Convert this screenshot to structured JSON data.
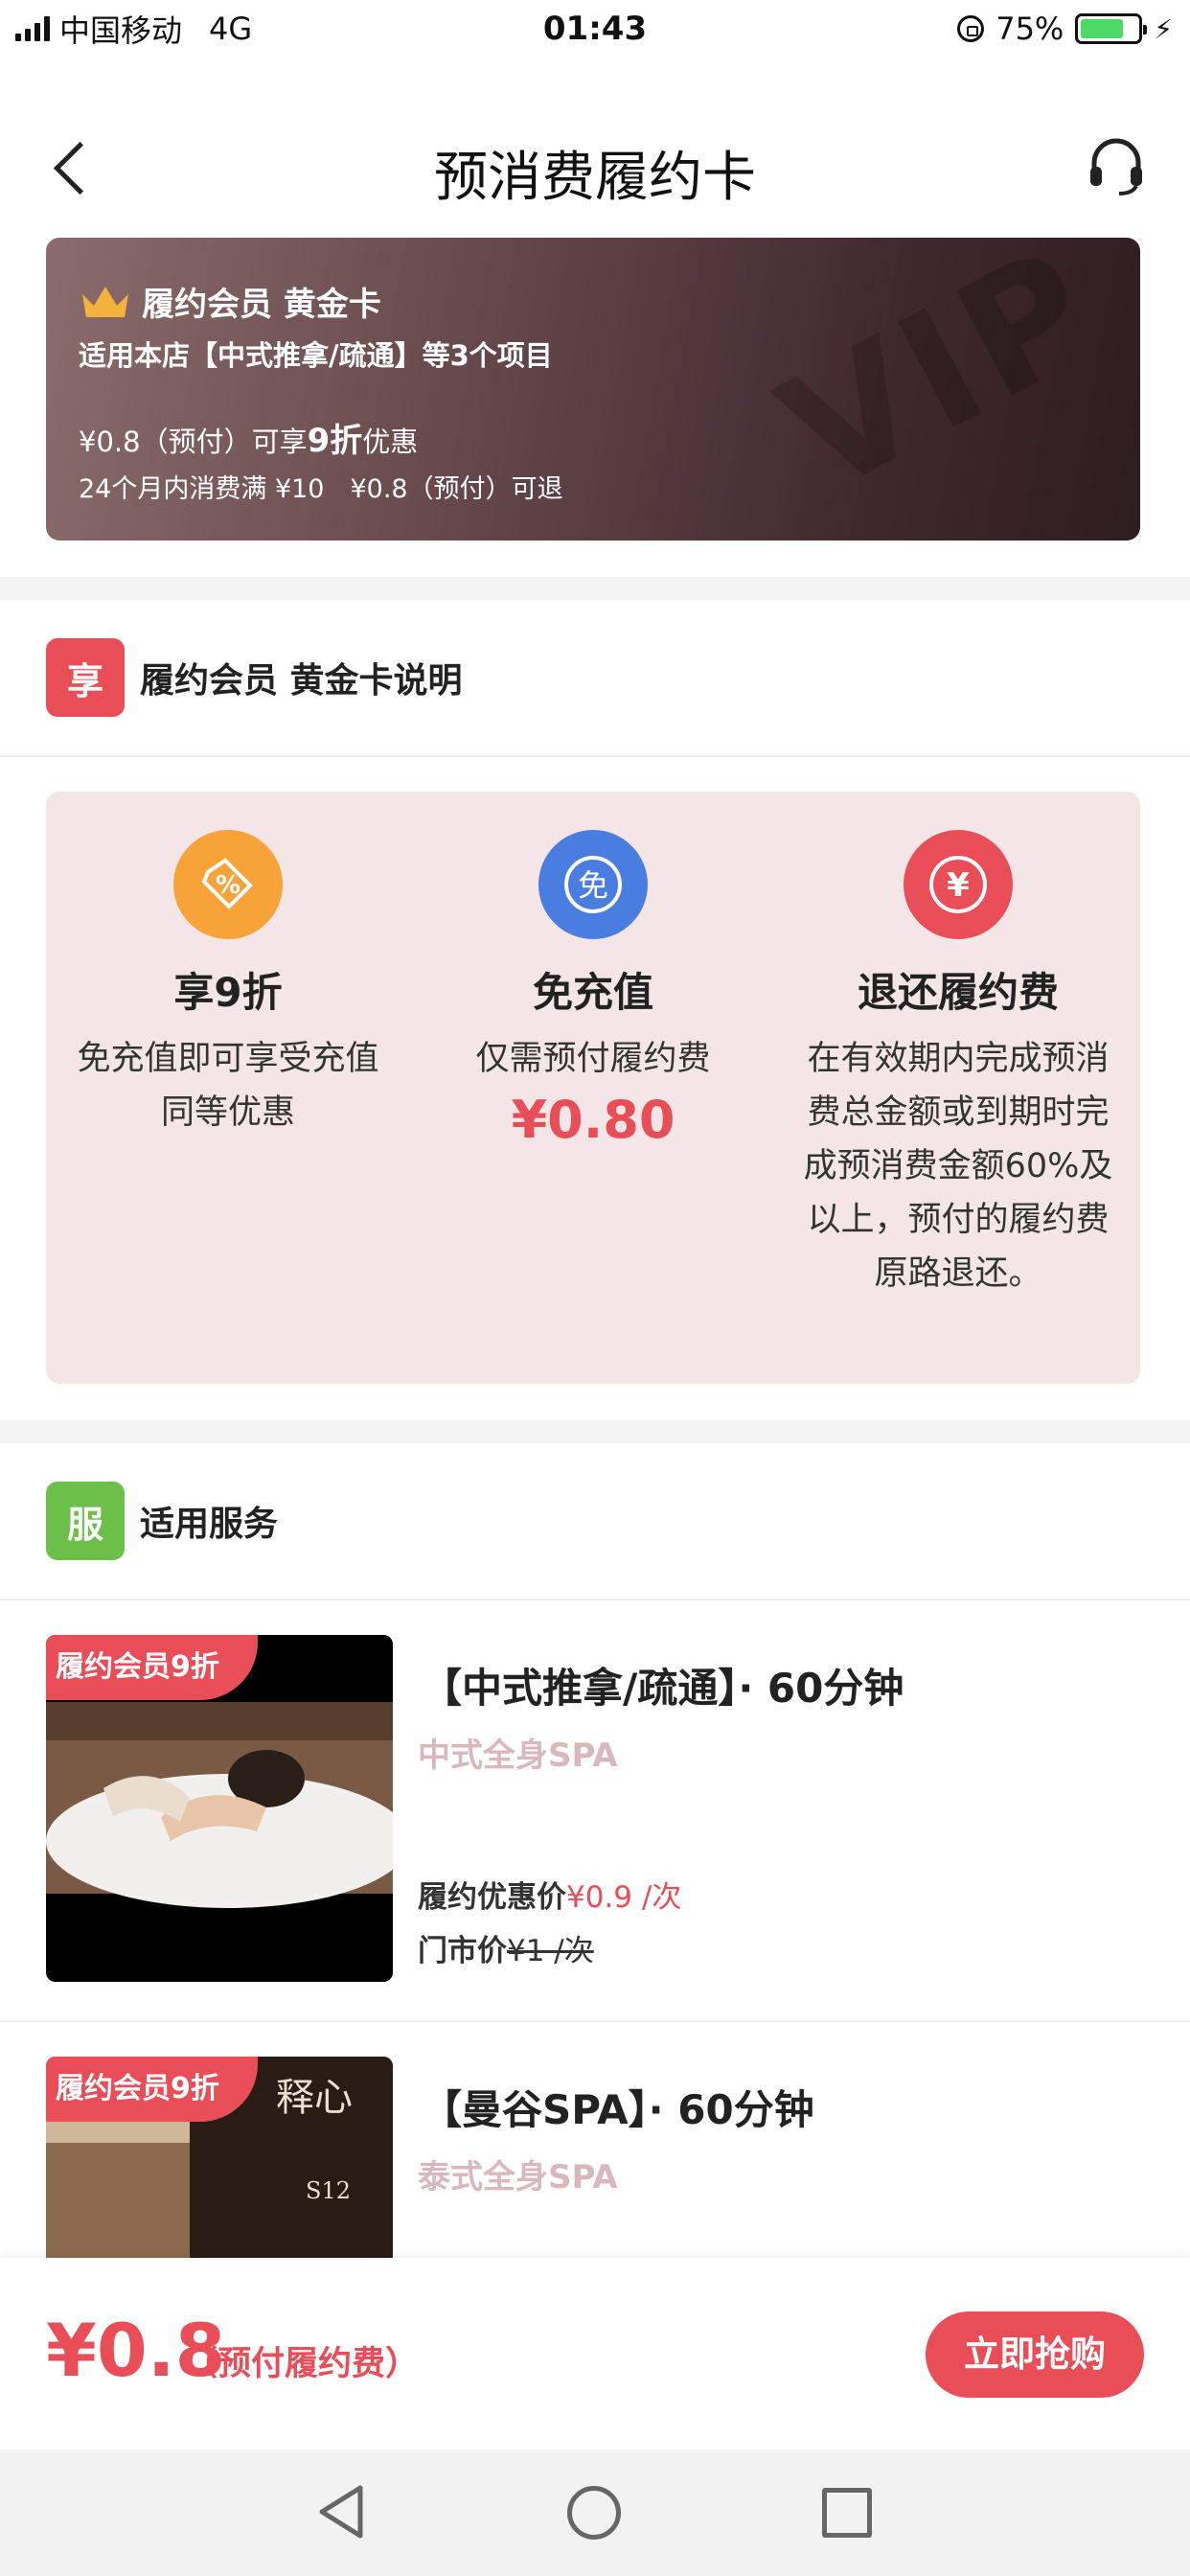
{
  "status_bar": {
    "carrier": "中国移动",
    "network": "4G",
    "time": "01:43",
    "battery": "75%",
    "battery_level": 0.75
  },
  "nav": {
    "title": "预消费履约卡",
    "back_icon": "back-chevron-icon",
    "service_icon": "headset-icon"
  },
  "card": {
    "title": "履约会员 黄金卡",
    "scope": "适用本店【中式推拿/疏通】等3个项目",
    "line1_prefix": "¥0.8（预付）可享",
    "line1_discount": "9折",
    "line1_suffix": "优惠",
    "line2": "24个月内消费满 ¥10　¥0.8（预付）可退",
    "watermark": "VIP"
  },
  "explain_section": {
    "badge": "享",
    "badge_color": "#e94e58",
    "title": "履约会员 黄金卡说明"
  },
  "benefits": [
    {
      "icon": "percent-tag-icon",
      "icon_color": "#f8a33a",
      "title": "享9折",
      "desc": "免充值即可享受充值同等优惠"
    },
    {
      "icon": "free-icon",
      "icon_color": "#4a7de0",
      "title": "免充值",
      "desc": "仅需预付履约费",
      "price": "¥0.80"
    },
    {
      "icon": "yen-icon",
      "icon_color": "#e94e58",
      "title": "退还履约费",
      "desc": "在有效期内完成预消费总金额或到期时完成预消费金额60%及以上，预付的履约费原路退还。"
    }
  ],
  "services_section": {
    "badge": "服",
    "badge_color": "#6cc04a",
    "title": "适用服务"
  },
  "services": [
    {
      "tag": "履约会员9折",
      "name": "【中式推拿/疏通】· 60分钟",
      "sub": "中式全身SPA",
      "price_label": "履约优惠价",
      "price": "¥0.9 /次",
      "orig_label": "门市价",
      "orig_price": "¥1 /次"
    },
    {
      "tag": "履约会员9折",
      "name": "【曼谷SPA】· 60分钟",
      "sub": "泰式全身SPA",
      "image_text": "释心",
      "image_room": "S12"
    }
  ],
  "bottom_bar": {
    "price": "¥0.8",
    "note": "（预付履约费）",
    "buy_label": "立即抢购"
  }
}
